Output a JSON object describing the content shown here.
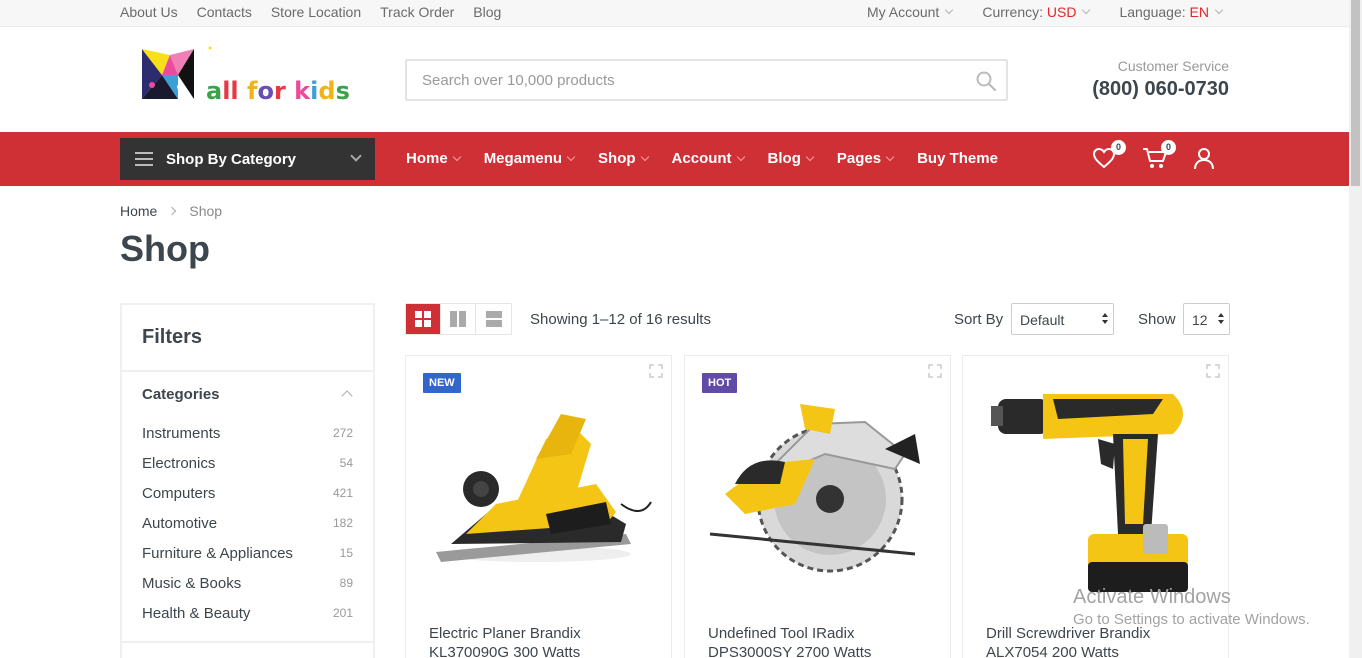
{
  "topbar": {
    "links": [
      "About Us",
      "Contacts",
      "Store Location",
      "Track Order",
      "Blog"
    ],
    "account": "My Account",
    "currency_label": "Currency:",
    "currency_value": "USD",
    "language_label": "Language:",
    "language_value": "EN"
  },
  "header": {
    "logo_text": "all for kids",
    "search_placeholder": "Search over 10,000 products",
    "customer_service_label": "Customer Service",
    "phone": "(800) 060-0730"
  },
  "nav": {
    "category_button": "Shop By Category",
    "items": [
      "Home",
      "Megamenu",
      "Shop",
      "Account",
      "Blog",
      "Pages",
      "Buy Theme"
    ],
    "wishlist_count": "0",
    "cart_count": "0"
  },
  "breadcrumb": {
    "home": "Home",
    "current": "Shop"
  },
  "page_title": "Shop",
  "filters": {
    "title": "Filters",
    "categories_title": "Categories",
    "categories": [
      {
        "name": "Instruments",
        "count": "272"
      },
      {
        "name": "Electronics",
        "count": "54"
      },
      {
        "name": "Computers",
        "count": "421"
      },
      {
        "name": "Automotive",
        "count": "182"
      },
      {
        "name": "Furniture & Appliances",
        "count": "15"
      },
      {
        "name": "Music & Books",
        "count": "89"
      },
      {
        "name": "Health & Beauty",
        "count": "201"
      }
    ]
  },
  "toolbar": {
    "results": "Showing 1–12 of 16 results",
    "sort_label": "Sort By",
    "sort_value": "Default",
    "show_label": "Show",
    "show_value": "12"
  },
  "products": [
    {
      "tag": "NEW",
      "tag_color": "#3366cc",
      "name": "Electric Planer Brandix KL370090G 300 Watts"
    },
    {
      "tag": "HOT",
      "tag_color": "#614ba6",
      "name": "Undefined Tool IRadix DPS3000SY 2700 Watts"
    },
    {
      "tag": "",
      "tag_color": "",
      "name": "Drill Screwdriver Brandix ALX7054 200 Watts"
    }
  ],
  "watermark": {
    "line1": "Activate Windows",
    "line2": "Go to Settings to activate Windows."
  },
  "colors": {
    "primary": "#cf3035",
    "dark": "#333333",
    "accent_text": "#e52727"
  }
}
